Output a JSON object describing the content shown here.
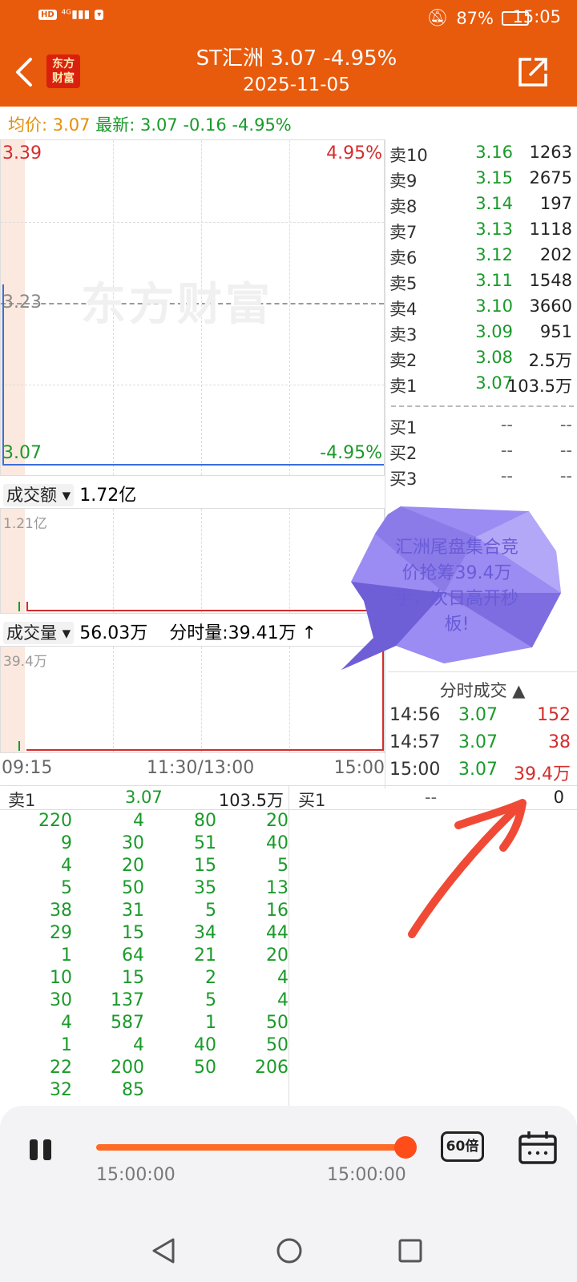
{
  "status": {
    "battery": "87%",
    "time": "15:05",
    "left_icons": [
      "HD",
      "4G",
      "signal",
      "notification"
    ]
  },
  "header": {
    "title": "ST汇洲  3.07  -4.95%",
    "date": "2025-11-05",
    "logo_line1": "东方",
    "logo_line2": "财富"
  },
  "summary": {
    "avg_label": "均价:",
    "avg_value": "3.07",
    "latest_label": "最新:",
    "latest_value": "3.07",
    "change": "-0.16",
    "change_pct": "-4.95%"
  },
  "price_chart": {
    "high_price": "3.39",
    "high_pct": "4.95%",
    "mid_price": "3.23",
    "low_price": "3.07",
    "low_pct": "-4.95%",
    "watermark": "东方财富"
  },
  "amount": {
    "label": "成交额",
    "value": "1.72亿",
    "scale": "1.21亿"
  },
  "volume": {
    "label": "成交量",
    "value": "56.03万",
    "fenshi": "分时量:39.41万 ↑",
    "scale": "39.4万"
  },
  "time_axis": [
    "09:15",
    "11:30/13:00",
    "15:00"
  ],
  "order_book": {
    "sells": [
      {
        "label": "卖10",
        "price": "3.16",
        "vol": "1263"
      },
      {
        "label": "卖9",
        "price": "3.15",
        "vol": "2675"
      },
      {
        "label": "卖8",
        "price": "3.14",
        "vol": "197"
      },
      {
        "label": "卖7",
        "price": "3.13",
        "vol": "1118"
      },
      {
        "label": "卖6",
        "price": "3.12",
        "vol": "202"
      },
      {
        "label": "卖5",
        "price": "3.11",
        "vol": "1548"
      },
      {
        "label": "卖4",
        "price": "3.10",
        "vol": "3660"
      },
      {
        "label": "卖3",
        "price": "3.09",
        "vol": "951"
      },
      {
        "label": "卖2",
        "price": "3.08",
        "vol": "2.5万"
      },
      {
        "label": "卖1",
        "price": "3.07",
        "vol": "103.5万"
      }
    ],
    "buys": [
      {
        "label": "买1",
        "price": "--",
        "vol": "--"
      },
      {
        "label": "买2",
        "price": "--",
        "vol": "--"
      },
      {
        "label": "买3",
        "price": "--",
        "vol": "--"
      }
    ]
  },
  "trades": {
    "title": "分时成交",
    "rows": [
      {
        "time": "14:56",
        "price": "3.07",
        "vol": "152"
      },
      {
        "time": "14:57",
        "price": "3.07",
        "vol": "38"
      },
      {
        "time": "15:00",
        "price": "3.07",
        "vol": "39.4万"
      }
    ]
  },
  "callout": {
    "text": "汇洲尾盘集合竞价抢筹39.4万手，次日高开秒板!"
  },
  "detail": {
    "sell_label": "卖1",
    "sell_price": "3.07",
    "sell_vol": "103.5万",
    "buy_label": "买1",
    "buy_price": "--",
    "buy_vol": "0",
    "rows": [
      [
        "220",
        "4",
        "80",
        "20"
      ],
      [
        "9",
        "30",
        "51",
        "40"
      ],
      [
        "4",
        "20",
        "15",
        "5"
      ],
      [
        "5",
        "50",
        "35",
        "13"
      ],
      [
        "38",
        "31",
        "5",
        "16"
      ],
      [
        "29",
        "15",
        "34",
        "44"
      ],
      [
        "1",
        "64",
        "21",
        "20"
      ],
      [
        "10",
        "15",
        "2",
        "4"
      ],
      [
        "30",
        "137",
        "5",
        "4"
      ],
      [
        "4",
        "587",
        "1",
        "50"
      ],
      [
        "1",
        "4",
        "40",
        "50"
      ],
      [
        "22",
        "200",
        "50",
        "206"
      ],
      [
        "32",
        "85",
        "",
        ""
      ]
    ]
  },
  "player": {
    "time_left": "15:00:00",
    "time_right": "15:00:00",
    "speed": "60倍",
    "progress": 1.0
  },
  "colors": {
    "header": "#e85a0c",
    "up": "#d62c2c",
    "down": "#1a9a2a",
    "avg": "#e3900c"
  }
}
